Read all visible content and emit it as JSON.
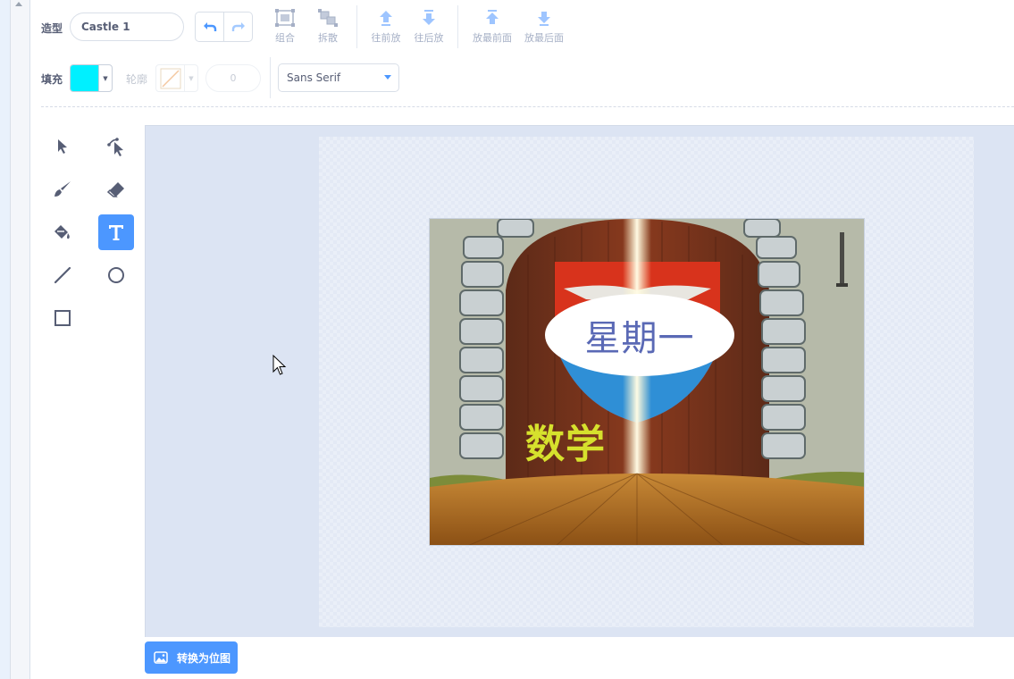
{
  "toolbar": {
    "costume_label": "造型",
    "costume_name": "Castle 1",
    "group_label": "组合",
    "ungroup_label": "拆散",
    "forward_label": "往前放",
    "backward_label": "往后放",
    "front_label": "放最前面",
    "back_label": "放最后面",
    "fill_label": "填充",
    "fill_color": "#00f0ff",
    "outline_label": "轮廓",
    "stroke_width": "0",
    "font_value": "Sans Serif"
  },
  "tools": [
    "select",
    "reshape",
    "brush",
    "eraser",
    "fill",
    "text",
    "line",
    "circle",
    "rectangle"
  ],
  "active_tool": "text",
  "canvas": {
    "ellipse_text": "星期一",
    "yellow_text": "数学"
  },
  "bottom": {
    "convert_label": "转换为位图"
  },
  "colors": {
    "accent": "#4c97ff",
    "ellipse_text": "#5a69b5",
    "yellow_text": "#d6e12d"
  }
}
